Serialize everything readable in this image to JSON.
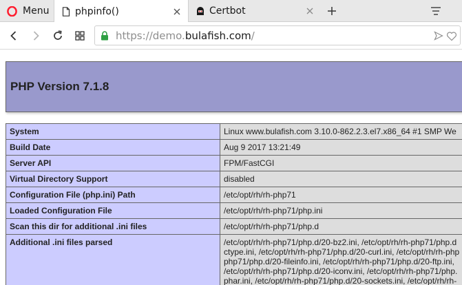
{
  "browser": {
    "menu_label": "Menu",
    "tabs": [
      {
        "title": "phpinfo()",
        "active": true
      },
      {
        "title": "Certbot",
        "active": false
      }
    ],
    "url": {
      "scheme": "https://",
      "subdomain": "demo.",
      "domain": "bulafish.com",
      "path": "/"
    },
    "colors": {
      "secure_lock": "#2ea043",
      "opera_red": "#ff1b2d"
    }
  },
  "php": {
    "title": "PHP Version 7.1.8",
    "rows": [
      {
        "key": "System",
        "lines": [
          "Linux www.bulafish.com 3.10.0-862.2.3.el7.x86_64 #1 SMP We"
        ]
      },
      {
        "key": "Build Date",
        "lines": [
          "Aug 9 2017 13:21:49"
        ]
      },
      {
        "key": "Server API",
        "lines": [
          "FPM/FastCGI"
        ]
      },
      {
        "key": "Virtual Directory Support",
        "lines": [
          "disabled"
        ]
      },
      {
        "key": "Configuration File (php.ini) Path",
        "lines": [
          "/etc/opt/rh/rh-php71"
        ]
      },
      {
        "key": "Loaded Configuration File",
        "lines": [
          "/etc/opt/rh/rh-php71/php.ini"
        ]
      },
      {
        "key": "Scan this dir for additional .ini files",
        "lines": [
          "/etc/opt/rh/rh-php71/php.d"
        ]
      },
      {
        "key": "Additional .ini files parsed",
        "lines": [
          "/etc/opt/rh/rh-php71/php.d/20-bz2.ini, /etc/opt/rh/rh-php71/php.d",
          "ctype.ini, /etc/opt/rh/rh-php71/php.d/20-curl.ini, /etc/opt/rh/rh-php",
          "php71/php.d/20-fileinfo.ini, /etc/opt/rh/rh-php71/php.d/20-ftp.ini,",
          "/etc/opt/rh/rh-php71/php.d/20-iconv.ini, /etc/opt/rh/rh-php71/php.",
          "phar.ini, /etc/opt/rh/rh-php71/php.d/20-sockets.ini, /etc/opt/rh/rh-"
        ]
      }
    ]
  }
}
